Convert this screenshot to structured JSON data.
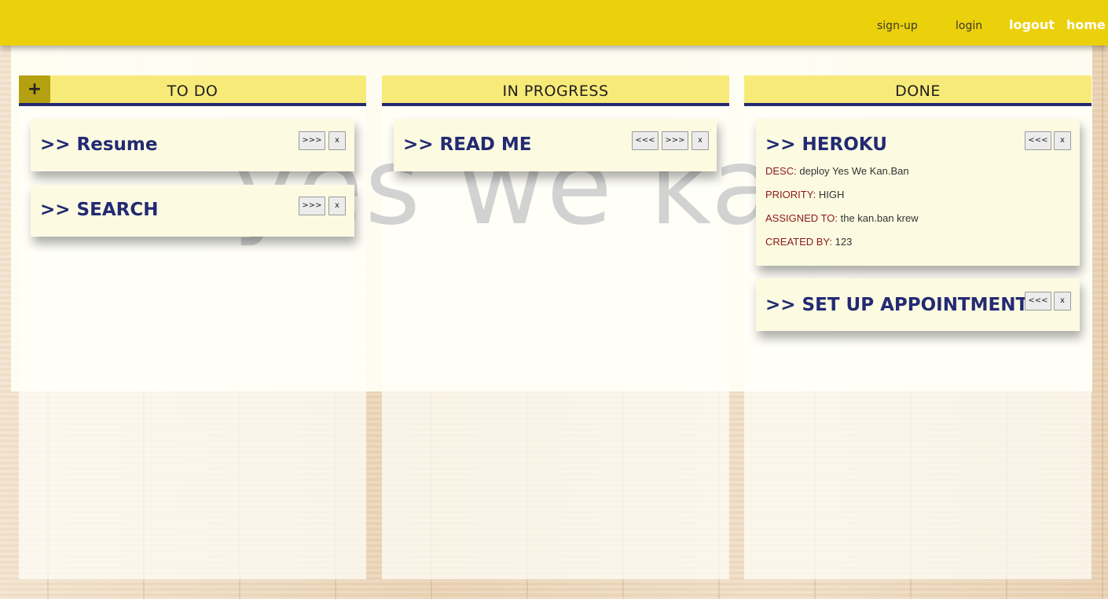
{
  "nav": {
    "signup": "sign-up",
    "login": "login",
    "logout": "logout",
    "home": "home"
  },
  "watermark": "yes we kan.ban",
  "add_button": "+",
  "columns": [
    {
      "title": "TO DO",
      "cards": [
        {
          "title": ">> Resume",
          "forward": ">>>",
          "delete": "x"
        },
        {
          "title": ">> SEARCH",
          "forward": ">>>",
          "delete": "x"
        }
      ]
    },
    {
      "title": "IN PROGRESS",
      "cards": [
        {
          "title": ">> READ ME",
          "back": "<<<",
          "forward": ">>>",
          "delete": "x"
        }
      ]
    },
    {
      "title": "DONE",
      "cards": [
        {
          "title": ">> HEROKU",
          "back": "<<<",
          "delete": "x",
          "details": {
            "desc_label": "DESC:",
            "desc": "deploy Yes We Kan.Ban",
            "priority_label": "PRIORITY:",
            "priority": "HIGH",
            "assigned_label": "ASSIGNED TO:",
            "assigned": "the kan.ban krew",
            "created_label": "CREATED BY:",
            "created": "123"
          }
        },
        {
          "title": ">> SET UP APPOINTMENT",
          "back": "<<<",
          "delete": "x"
        }
      ]
    }
  ],
  "colors": {
    "topbar": "#ebd00c",
    "header": "#f8ea79",
    "header_border": "#262a6f",
    "card_title": "#232a72",
    "detail_label": "#8b1a1a"
  }
}
